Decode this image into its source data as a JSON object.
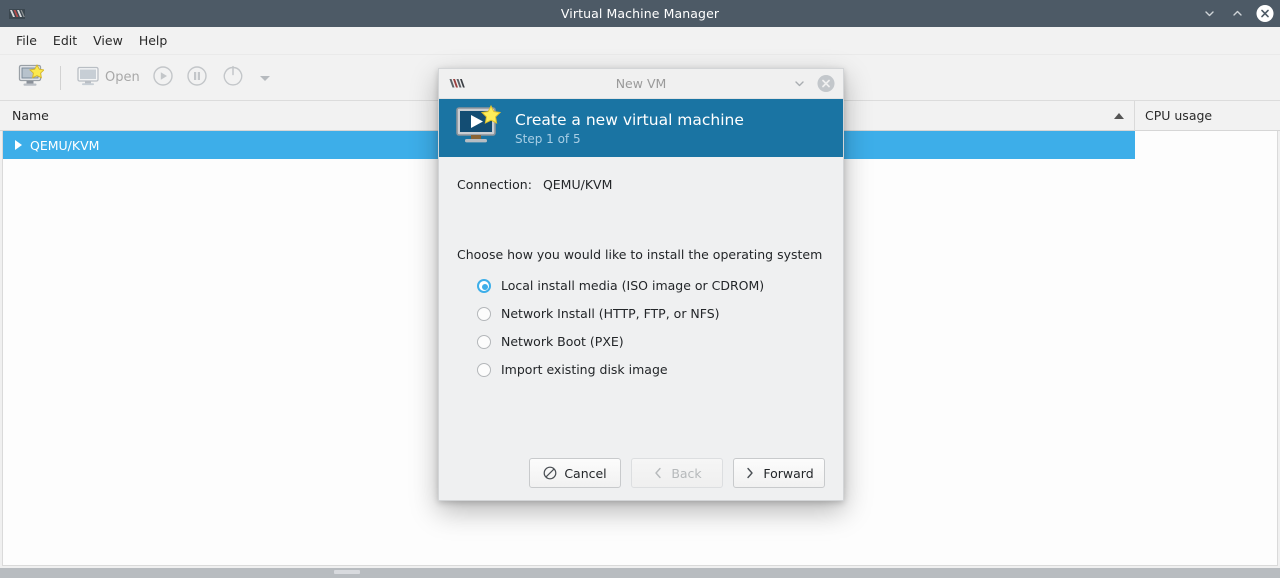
{
  "window": {
    "title": "Virtual Machine Manager",
    "icon": "vmm-app-icon",
    "controls": [
      {
        "name": "minimize-button",
        "icon": "chevron-down-icon"
      },
      {
        "name": "maximize-button",
        "icon": "chevron-up-icon"
      },
      {
        "name": "close-button",
        "icon": "close-circle-icon"
      }
    ]
  },
  "menubar": {
    "items": [
      {
        "label": "File"
      },
      {
        "label": "Edit"
      },
      {
        "label": "View"
      },
      {
        "label": "Help"
      }
    ]
  },
  "toolbar": {
    "new_vm": {
      "icon": "new-virtual-machine-icon",
      "label": ""
    },
    "open": {
      "icon": "monitor-icon",
      "label": "Open",
      "enabled": false
    },
    "run": {
      "icon": "play-circle-icon",
      "enabled": false
    },
    "pause": {
      "icon": "pause-circle-icon",
      "enabled": false
    },
    "shutdown": {
      "icon": "power-circle-icon",
      "enabled": false
    },
    "more": {
      "icon": "caret-down-icon",
      "enabled": false
    }
  },
  "list": {
    "columns": [
      {
        "label": "Name",
        "sort": "ascending"
      },
      {
        "label": "CPU usage"
      }
    ],
    "rows": [
      {
        "name": "QEMU/KVM",
        "cpu": "",
        "selected": true,
        "expandable": true
      }
    ]
  },
  "dialog": {
    "titlebar": {
      "title": "New VM",
      "icon": "vmm-app-icon",
      "controls": [
        {
          "name": "dialog-menu-button",
          "icon": "chevron-down-icon"
        },
        {
          "name": "dialog-close-button",
          "icon": "close-circle-icon"
        }
      ]
    },
    "header": {
      "title": "Create a new virtual machine",
      "subtitle": "Step 1 of 5",
      "icon": "new-virtual-machine-icon",
      "background_color": "#1a74a3"
    },
    "connection": {
      "label": "Connection:",
      "value": "QEMU/KVM"
    },
    "prompt": "Choose how you would like to install the operating system",
    "install_options": [
      {
        "label": "Local install media (ISO image or CDROM)",
        "selected": true
      },
      {
        "label": "Network Install (HTTP, FTP, or NFS)",
        "selected": false
      },
      {
        "label": "Network Boot (PXE)",
        "selected": false
      },
      {
        "label": "Import existing disk image",
        "selected": false
      }
    ],
    "buttons": {
      "cancel": {
        "label": "Cancel",
        "icon": "no-entry-icon",
        "enabled": true
      },
      "back": {
        "label": "Back",
        "icon": "chevron-left-icon",
        "enabled": false
      },
      "forward": {
        "label": "Forward",
        "icon": "chevron-right-icon",
        "enabled": true
      }
    }
  },
  "colors": {
    "titlebar": "#4d5a66",
    "selection": "#3daee9",
    "dialog_header": "#1a74a3",
    "chrome": "#f2f2f2"
  }
}
